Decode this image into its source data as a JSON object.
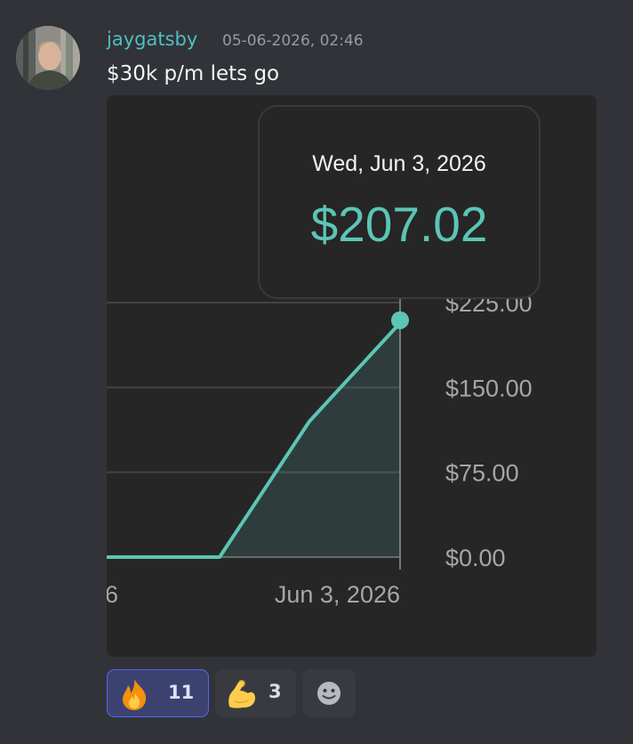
{
  "message": {
    "author": "jaygatsby",
    "timestamp": "05-06-2026, 02:46",
    "content": "$30k p/m lets go",
    "author_color": "#4fc0bf"
  },
  "embed": {
    "tooltip": {
      "date": "Wed, Jun 3, 2026",
      "value": "$207.02"
    }
  },
  "chart_data": {
    "type": "area",
    "x_tick_labels": [
      "6",
      "Jun 3, 2026"
    ],
    "y_tick_labels": [
      "$0.00",
      "$75.00",
      "$150.00",
      "$225.00"
    ],
    "ylim": [
      0,
      225
    ],
    "grid": true,
    "line_color": "#5cc5b5",
    "series": [
      {
        "values": [
          0,
          0,
          0,
          120,
          207.02
        ]
      }
    ]
  },
  "reactions": [
    {
      "emoji": "fire-icon",
      "count": "11",
      "active": true
    },
    {
      "emoji": "flexed-biceps-icon",
      "count": "3",
      "active": false
    },
    {
      "emoji": "add-reaction-icon",
      "count": "",
      "active": false
    }
  ]
}
